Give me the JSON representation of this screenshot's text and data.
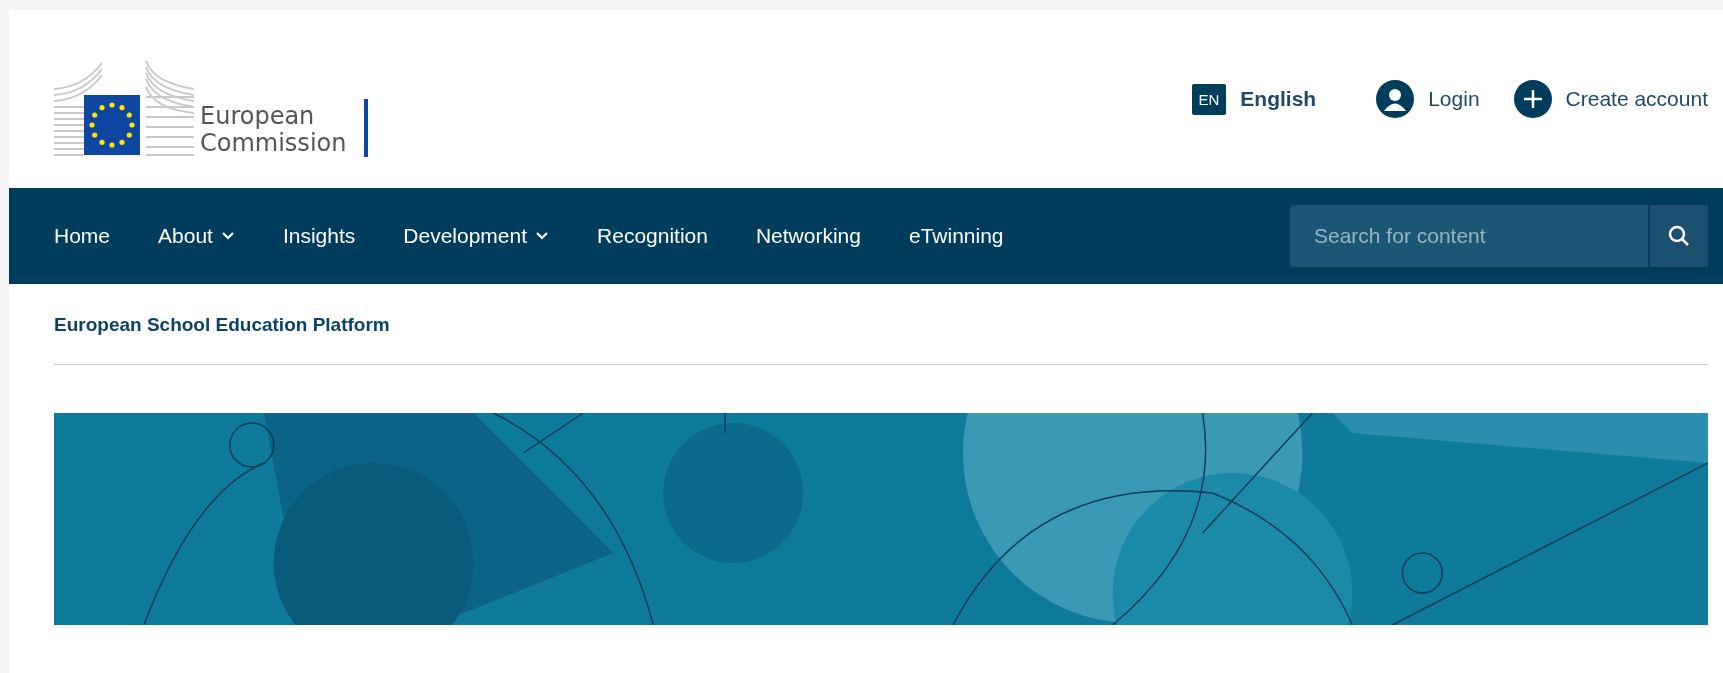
{
  "logo": {
    "line_1": "European",
    "line_2": "Commission"
  },
  "header_links": {
    "language": {
      "code": "EN",
      "label": "English"
    },
    "login": "Login",
    "create_account": "Create account"
  },
  "nav": [
    {
      "label": "Home",
      "kind": "link"
    },
    {
      "label": "About",
      "kind": "dropdown"
    },
    {
      "label": "Insights",
      "kind": "link"
    },
    {
      "label": "Development",
      "kind": "dropdown"
    },
    {
      "label": "Recognition",
      "kind": "link"
    },
    {
      "label": "Networking",
      "kind": "link"
    },
    {
      "label": "eTwinning",
      "kind": "link"
    }
  ],
  "search": {
    "placeholder": "Search for content"
  },
  "site_title": "European School Education Platform"
}
